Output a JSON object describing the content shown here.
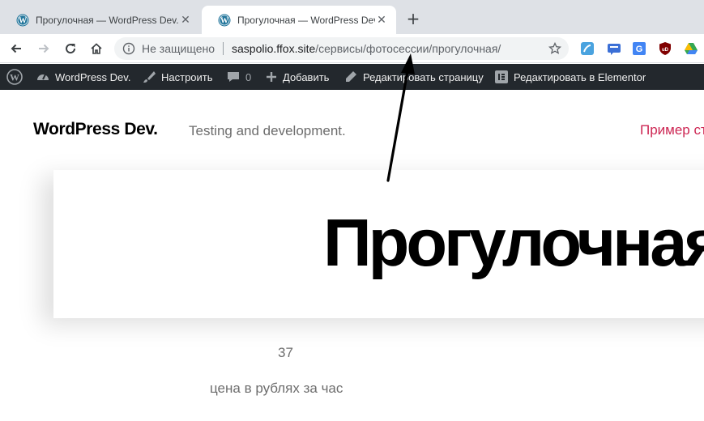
{
  "browser": {
    "tabs": [
      {
        "title": "Прогулочная — WordPress Dev.",
        "active": false
      },
      {
        "title": "Прогулочная — WordPress Dev.",
        "active": true
      }
    ],
    "address": {
      "security_label": "Не защищено",
      "host": "saspolio.ffox.site",
      "path": "/сервисы/фотосессии/прогулочная/"
    },
    "extensions": [
      "translate-icon",
      "chat-icon",
      "google-translate-icon",
      "ublock-icon",
      "drive-icon"
    ]
  },
  "admin_bar": {
    "site_name": "WordPress Dev.",
    "customize": "Настроить",
    "comments_count": "0",
    "add_new": "Добавить",
    "edit_page": "Редактировать страницу",
    "edit_elementor": "Редактировать в Elementor"
  },
  "site": {
    "title": "WordPress Dev.",
    "description": "Testing and development.",
    "nav_item": "Пример ст"
  },
  "page": {
    "heading": "Прогулочная",
    "price": "37",
    "price_caption": "цена в рублях за час"
  },
  "colors": {
    "admin_bar_bg": "#23282d",
    "nav_accent": "#cd2653",
    "tab_strip_bg": "#dee1e6"
  }
}
